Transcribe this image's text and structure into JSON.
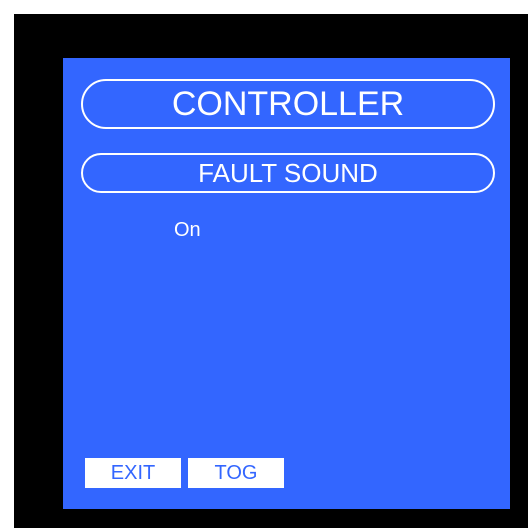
{
  "screen": {
    "title": "CONTROLLER",
    "subtitle": "FAULT SOUND",
    "value": "On"
  },
  "softkeys": {
    "exit_label": "EXIT",
    "toggle_label": "TOG"
  },
  "colors": {
    "screen_background": "#3366ff",
    "frame": "#000000",
    "text": "#ffffff"
  }
}
